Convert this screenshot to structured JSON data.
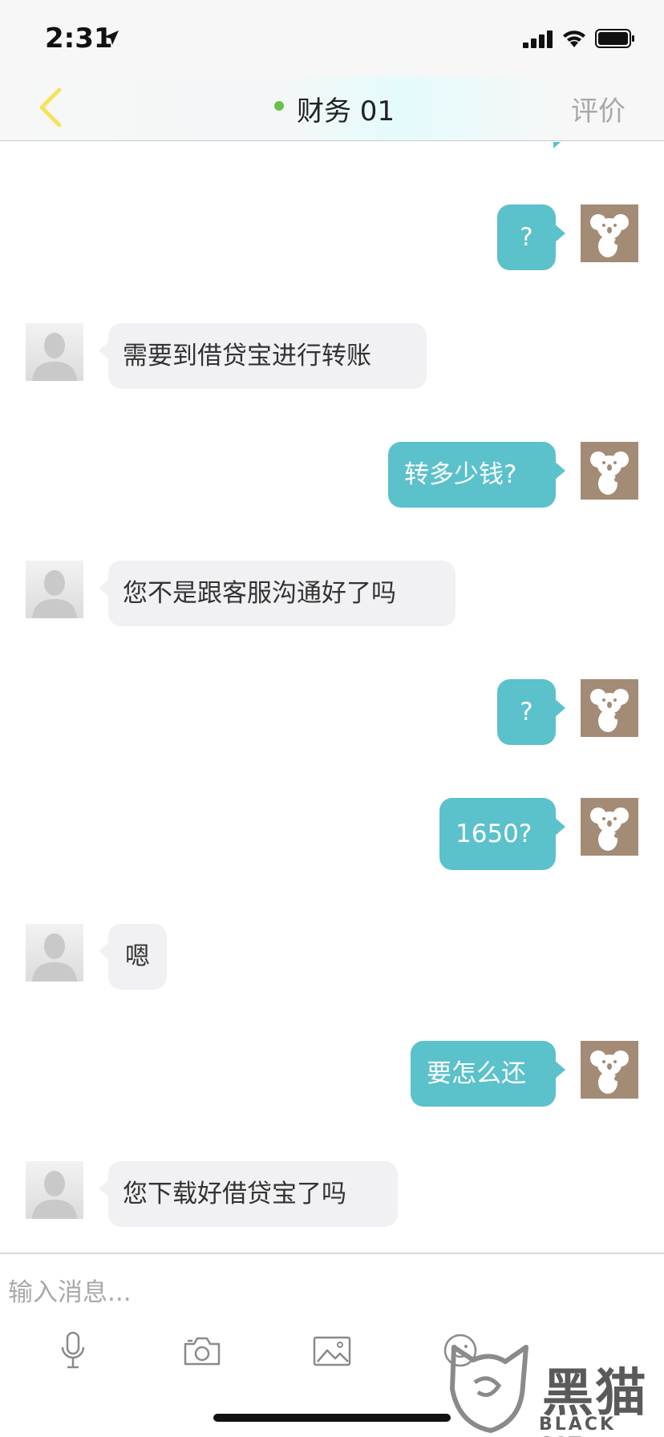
{
  "status_bar": {
    "time": "2:31"
  },
  "nav": {
    "title": "财务 01",
    "rate_label": "评价",
    "online_color": "#6cc04a"
  },
  "colors": {
    "accent_back": "#f5e35a",
    "right_bubble": "#5bc1cb",
    "left_bubble": "#f1f1f4",
    "koala_avatar_bg": "#a48b75"
  },
  "messages": [
    {
      "side": "right",
      "text": "?"
    },
    {
      "side": "left",
      "text": "需要到借贷宝进行转账"
    },
    {
      "side": "right",
      "text": "转多少钱?"
    },
    {
      "side": "left",
      "text": "您不是跟客服沟通好了吗"
    },
    {
      "side": "right",
      "text": "?"
    },
    {
      "side": "right",
      "text": "1650?"
    },
    {
      "side": "left",
      "text": "嗯"
    },
    {
      "side": "right",
      "text": "要怎么还"
    },
    {
      "side": "left",
      "text": "您下载好借贷宝了吗"
    }
  ],
  "input": {
    "placeholder": "输入消息..."
  },
  "toolbar": {
    "items": [
      "microphone-icon",
      "camera-icon",
      "image-icon",
      "emoji-icon"
    ]
  },
  "watermark": {
    "title": "黑猫",
    "subtitle": "BLACK CAT"
  }
}
